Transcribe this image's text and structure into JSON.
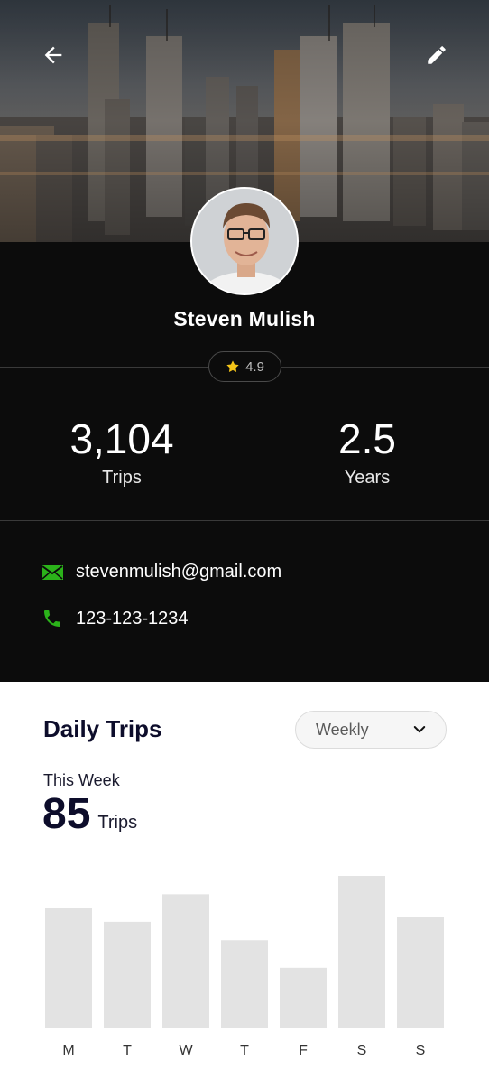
{
  "header": {
    "back_icon": "arrow-left-icon",
    "edit_icon": "pencil-icon"
  },
  "profile": {
    "name": "Steven Mulish",
    "rating": "4.9",
    "rating_icon": "star-icon",
    "star_color": "#f5c518"
  },
  "stats": [
    {
      "value": "3,104",
      "label": "Trips"
    },
    {
      "value": "2.5",
      "label": "Years"
    }
  ],
  "contact": {
    "email": "stevenmulish@gmail.com",
    "phone": "123-123-1234",
    "icon_color": "#2bb31a"
  },
  "daily_trips": {
    "title": "Daily Trips",
    "period": "Weekly",
    "week_label": "This Week",
    "total": "85",
    "unit": "Trips"
  },
  "chart_data": {
    "type": "bar",
    "categories": [
      "M",
      "T",
      "W",
      "T",
      "F",
      "S",
      "S"
    ],
    "values": [
      13,
      11.5,
      14.5,
      9.5,
      6.5,
      16.5,
      12
    ]
  }
}
